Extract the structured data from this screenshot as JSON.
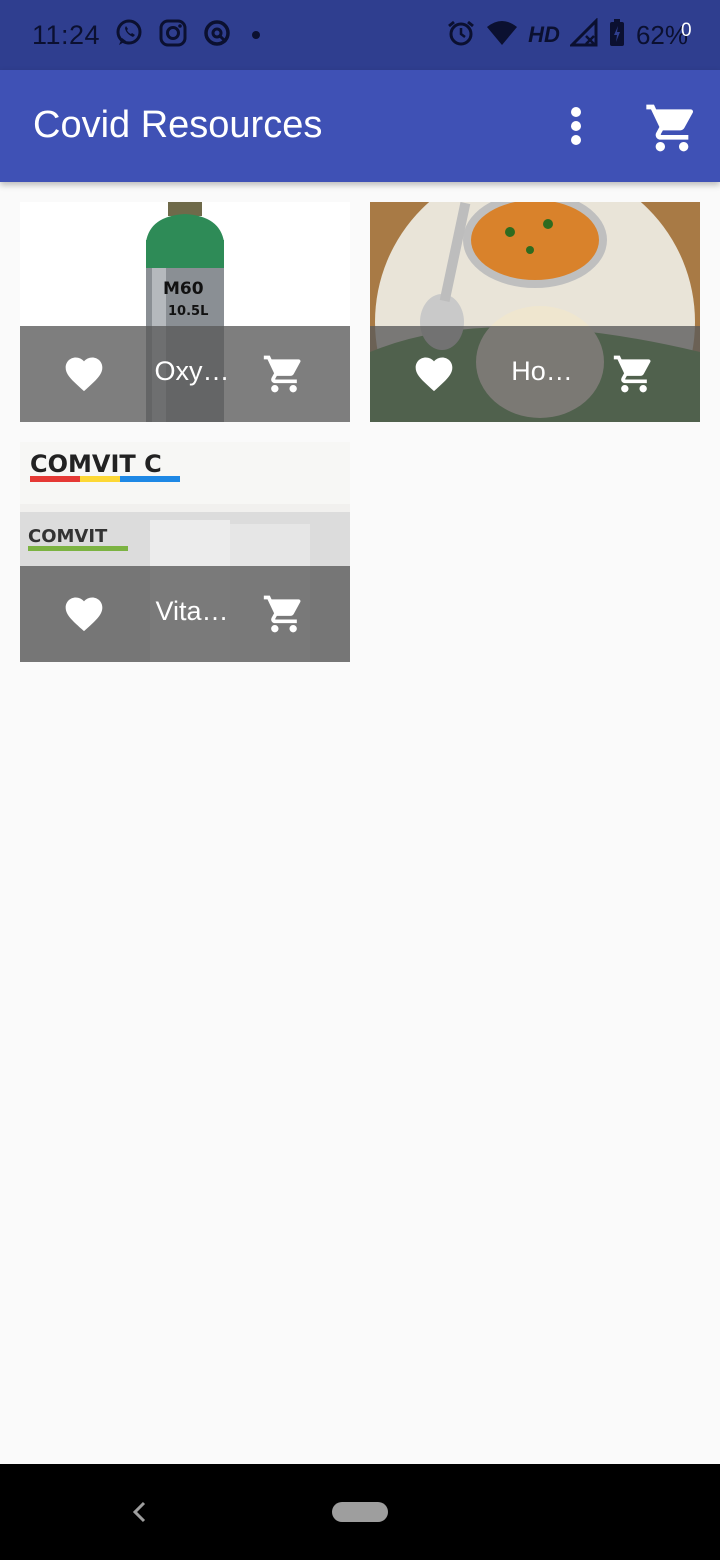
{
  "status_bar": {
    "time": "11:24",
    "battery": "62%",
    "network_label": "HD",
    "left_icons": [
      "whatsapp-icon",
      "instagram-icon",
      "app-notification-icon",
      "dot-icon"
    ],
    "right_icons": [
      "alarm-icon",
      "wifi-icon",
      "signal-icon",
      "battery-icon"
    ]
  },
  "app_bar": {
    "title": "Covid Resources",
    "cart_count": "0",
    "background": "#3f51b5"
  },
  "products": [
    {
      "label": "Oxy…",
      "image": "oxygen cylinder"
    },
    {
      "label": "Ho…",
      "image": "home food plate"
    },
    {
      "label": "Vita…",
      "image": "vitamin c packets"
    }
  ],
  "nav_bar": {
    "icons": [
      "back-icon",
      "home-pill"
    ]
  }
}
